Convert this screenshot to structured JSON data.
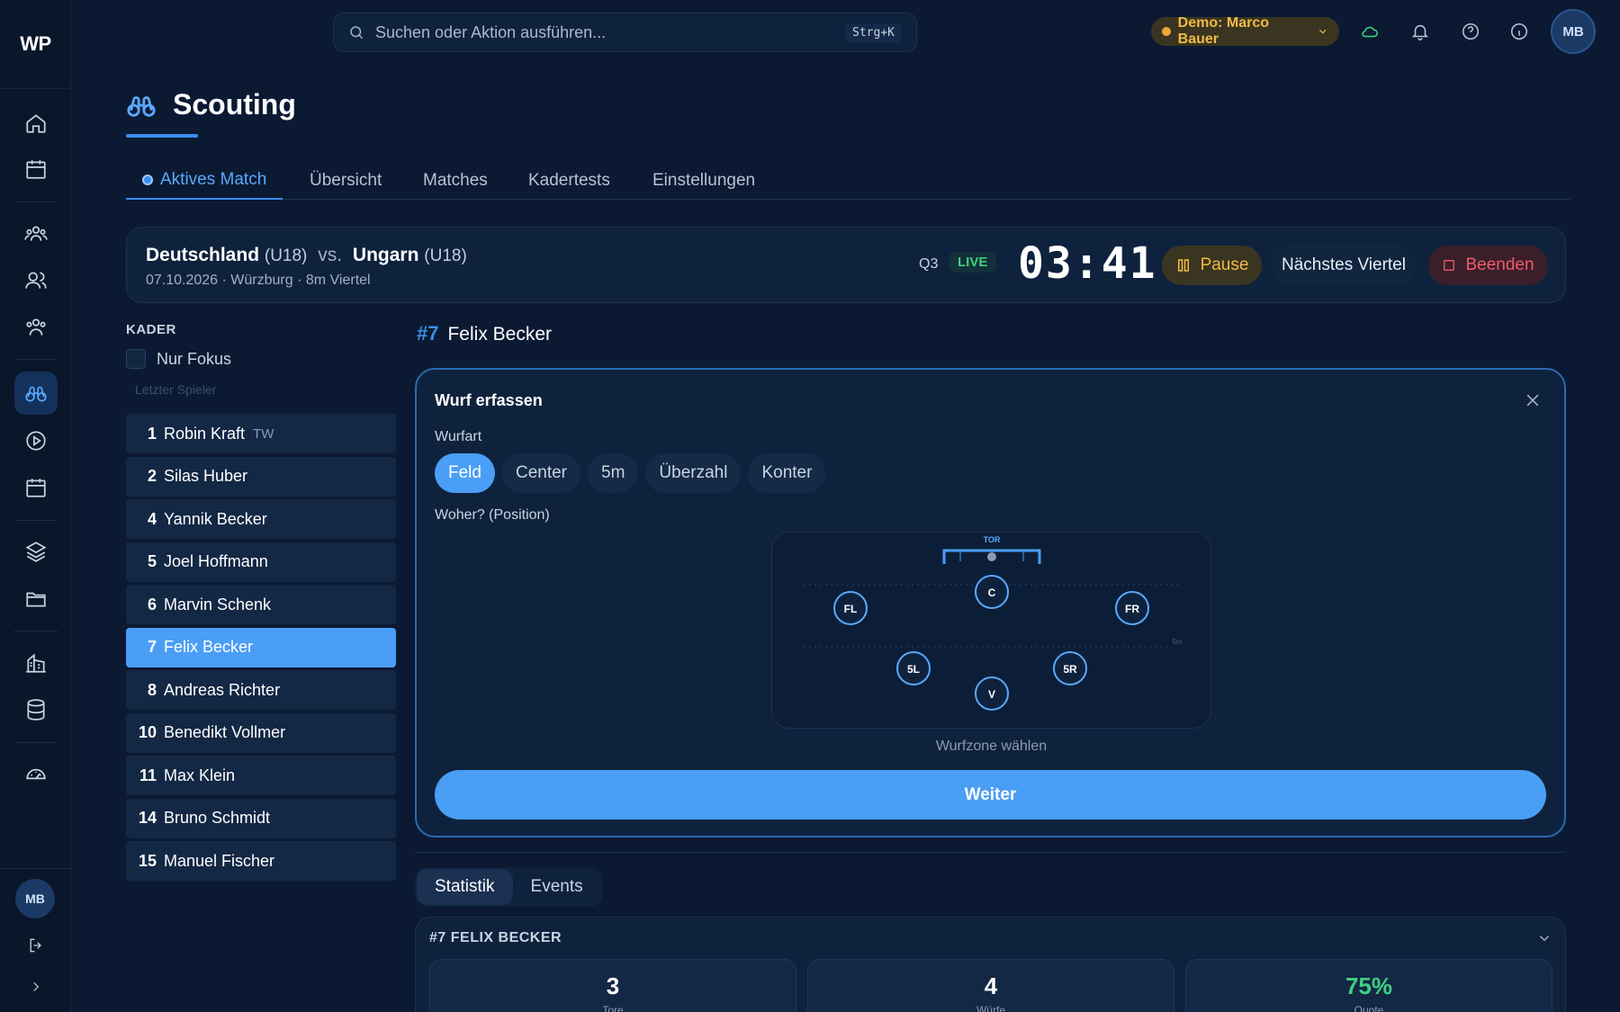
{
  "app": {
    "logo": "WP"
  },
  "search": {
    "placeholder": "Suchen oder Aktion ausführen...",
    "shortcut": "Strg+K"
  },
  "topbar": {
    "demo_label": "Demo: Marco Bauer",
    "avatar": "MB",
    "icons": [
      "cloud-icon",
      "bell-icon",
      "help-icon",
      "info-icon"
    ]
  },
  "sidebar": {
    "icons": [
      "home-icon",
      "calendar-icon",
      "team-icon",
      "users-icon",
      "group-icon",
      "binoculars-icon",
      "play-icon",
      "calendar-2-icon",
      "layers-icon",
      "folder-icon",
      "building-icon",
      "database-icon",
      "gauge-icon"
    ],
    "avatar": "MB"
  },
  "page": {
    "title": "Scouting"
  },
  "tabs": [
    {
      "label": "Aktives Match",
      "active": true
    },
    {
      "label": "Übersicht"
    },
    {
      "label": "Matches"
    },
    {
      "label": "Kadertests"
    },
    {
      "label": "Einstellungen"
    }
  ],
  "match": {
    "home": "Deutschland",
    "home_age": "(U18)",
    "vs": "vs.",
    "away": "Ungarn",
    "away_age": "(U18)",
    "meta": "07.10.2026 · Würzburg · 8m Viertel",
    "quarter": "Q3",
    "live": "LIVE",
    "timer": "03:41",
    "pause": "Pause",
    "next": "Nächstes Viertel",
    "end": "Beenden"
  },
  "squad": {
    "label": "KADER",
    "focus_label": "Nur Fokus",
    "last_player": "Letzter Spieler",
    "players": [
      {
        "num": "1",
        "name": "Robin Kraft",
        "pos": "TW"
      },
      {
        "num": "2",
        "name": "Silas Huber",
        "pos": ""
      },
      {
        "num": "4",
        "name": "Yannik Becker",
        "pos": ""
      },
      {
        "num": "5",
        "name": "Joel Hoffmann",
        "pos": ""
      },
      {
        "num": "6",
        "name": "Marvin Schenk",
        "pos": ""
      },
      {
        "num": "7",
        "name": "Felix Becker",
        "pos": "",
        "selected": true
      },
      {
        "num": "8",
        "name": "Andreas Richter",
        "pos": ""
      },
      {
        "num": "10",
        "name": "Benedikt Vollmer",
        "pos": ""
      },
      {
        "num": "11",
        "name": "Max Klein",
        "pos": ""
      },
      {
        "num": "14",
        "name": "Bruno Schmidt",
        "pos": ""
      },
      {
        "num": "15",
        "name": "Manuel Fischer",
        "pos": ""
      }
    ]
  },
  "selected_player": {
    "hash": "#7",
    "name": "Felix Becker"
  },
  "shot": {
    "title": "Wurf erfassen",
    "type_label": "Wurfart",
    "types": [
      {
        "label": "Feld",
        "active": true
      },
      {
        "label": "Center"
      },
      {
        "label": "5m"
      },
      {
        "label": "Überzahl"
      },
      {
        "label": "Konter"
      }
    ],
    "position_label": "Woher? (Position)",
    "court": {
      "goal_label": "TOR",
      "line_label": "5m",
      "zones": [
        "FL",
        "C",
        "FR",
        "5L",
        "V",
        "5R"
      ]
    },
    "zone_hint": "Wurfzone wählen",
    "submit": "Weiter"
  },
  "subtabs": [
    {
      "label": "Statistik",
      "active": true
    },
    {
      "label": "Events"
    }
  ],
  "stats": {
    "title": "#7 FELIX BECKER",
    "items": [
      {
        "value": "3",
        "label": "Tore"
      },
      {
        "value": "4",
        "label": "Würfe"
      },
      {
        "value": "75%",
        "label": "Quote",
        "color": "#3ed07e"
      }
    ]
  }
}
